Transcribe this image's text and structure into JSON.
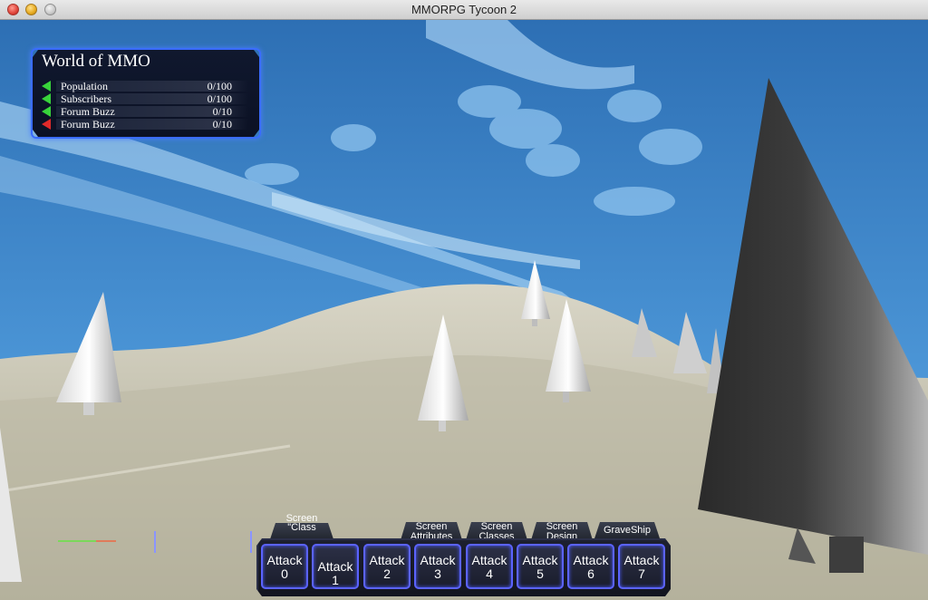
{
  "window": {
    "title": "MMORPG Tycoon 2"
  },
  "stats": {
    "heading": "World of MMO",
    "rows": [
      {
        "label": "Population",
        "value": "0/100",
        "trend": "up"
      },
      {
        "label": "Subscribers",
        "value": "0/100",
        "trend": "up"
      },
      {
        "label": "Forum Buzz",
        "value": "0/10",
        "trend": "up"
      },
      {
        "label": "Forum Buzz",
        "value": "0/10",
        "trend": "down"
      }
    ]
  },
  "tabs": {
    "class_top": "Screen",
    "class_bottom": "\"Class",
    "attributes_top": "Screen",
    "attributes_bottom": "Attributes",
    "classes_top": "Screen",
    "classes_bottom": "Classes",
    "design_top": "Screen",
    "design_bottom": "Design",
    "graveship": "GraveShip"
  },
  "actions": [
    {
      "line1": "Attack",
      "line2": "0"
    },
    {
      "line1": "Attack 1",
      "line2": ""
    },
    {
      "line1": "Attack",
      "line2": "2"
    },
    {
      "line1": "Attack",
      "line2": "3"
    },
    {
      "line1": "Attack",
      "line2": "4"
    },
    {
      "line1": "Attack",
      "line2": "5"
    },
    {
      "line1": "Attack",
      "line2": "6"
    },
    {
      "line1": "Attack",
      "line2": "7"
    }
  ],
  "colors": {
    "sky": "#3b83c6",
    "ground": "#c9c6b4",
    "ui_border": "#3a6cff",
    "trend_up": "#38d33b",
    "trend_down": "#e02a2a"
  }
}
